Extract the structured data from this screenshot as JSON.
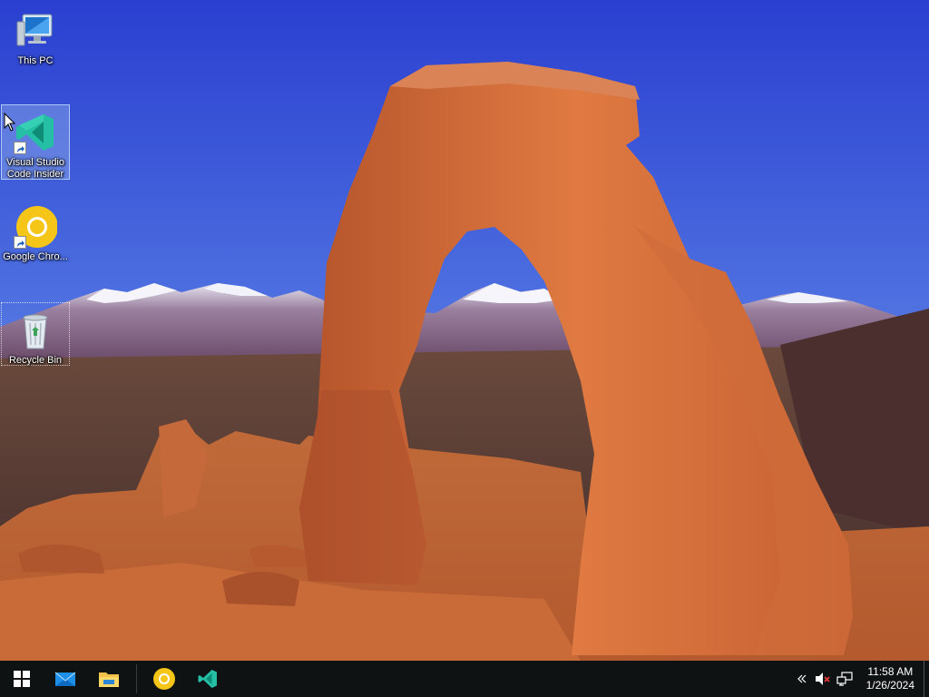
{
  "desktop": {
    "icons": [
      {
        "label": "This PC"
      },
      {
        "label": "Visual Studio Code Insider"
      },
      {
        "label": "Google Chro..."
      },
      {
        "label": "Recycle Bin"
      }
    ]
  },
  "taskbar": {
    "pinned": [
      {
        "name": "Start"
      },
      {
        "name": "Mail"
      },
      {
        "name": "File Explorer"
      },
      {
        "name": "Google Chrome"
      },
      {
        "name": "Visual Studio Code Insider"
      }
    ],
    "clock": {
      "time": "11:58 AM",
      "date": "1/26/2024"
    }
  },
  "colors": {
    "taskbar_bg": "#0f1213",
    "sky_top": "#2a3fd0",
    "sky_bottom": "#8cb3ec",
    "vscode_insiders": "#24bfa5",
    "chrome_yellow": "#f5c518"
  }
}
